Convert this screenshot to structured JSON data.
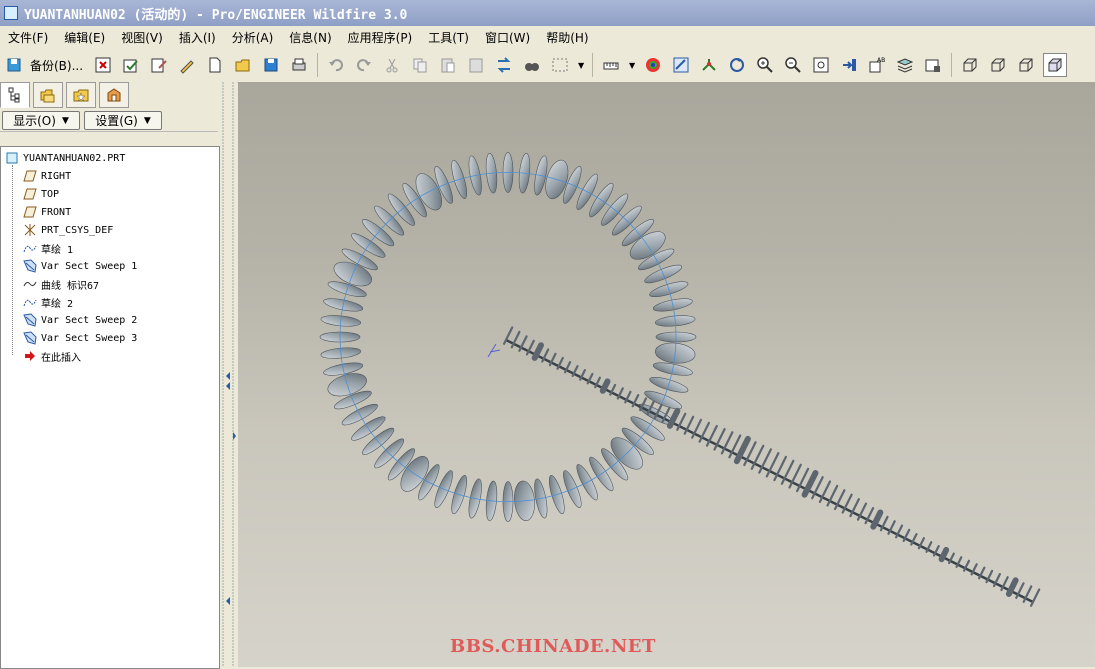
{
  "window": {
    "title": "YUANTANHUAN02 (活动的) - Pro/ENGINEER Wildfire 3.0"
  },
  "menu": [
    {
      "label": "文件(F)"
    },
    {
      "label": "编辑(E)"
    },
    {
      "label": "视图(V)"
    },
    {
      "label": "插入(I)"
    },
    {
      "label": "分析(A)"
    },
    {
      "label": "信息(N)"
    },
    {
      "label": "应用程序(P)"
    },
    {
      "label": "工具(T)"
    },
    {
      "label": "窗口(W)"
    },
    {
      "label": "帮助(H)"
    }
  ],
  "toolbar": {
    "backup_label": "备份(B)..."
  },
  "panel": {
    "display_btn": "显示(O)",
    "settings_btn": "设置(G)"
  },
  "tree": [
    {
      "label": "YUANTANHUAN02.PRT",
      "icon": "part-icon"
    },
    {
      "label": "RIGHT",
      "icon": "datum-plane-icon"
    },
    {
      "label": "TOP",
      "icon": "datum-plane-icon"
    },
    {
      "label": "FRONT",
      "icon": "datum-plane-icon"
    },
    {
      "label": "PRT_CSYS_DEF",
      "icon": "csys-icon"
    },
    {
      "label": "草绘 1",
      "icon": "sketch-icon"
    },
    {
      "label": "Var Sect Sweep 1",
      "icon": "sweep-icon"
    },
    {
      "label": "曲线 标识67",
      "icon": "curve-icon"
    },
    {
      "label": "草绘 2",
      "icon": "sketch-icon"
    },
    {
      "label": "Var Sect Sweep 2",
      "icon": "sweep-icon"
    },
    {
      "label": "Var Sect Sweep 3",
      "icon": "sweep-icon"
    },
    {
      "label": "在此插入",
      "icon": "insert-arrow-icon"
    }
  ],
  "viewport": {
    "watermark": "BBS.CHINADE.NET"
  },
  "colors": {
    "title_bg": "#8e9fc6",
    "spring": "#9ca6ad",
    "watermark": "#e05a5a"
  }
}
